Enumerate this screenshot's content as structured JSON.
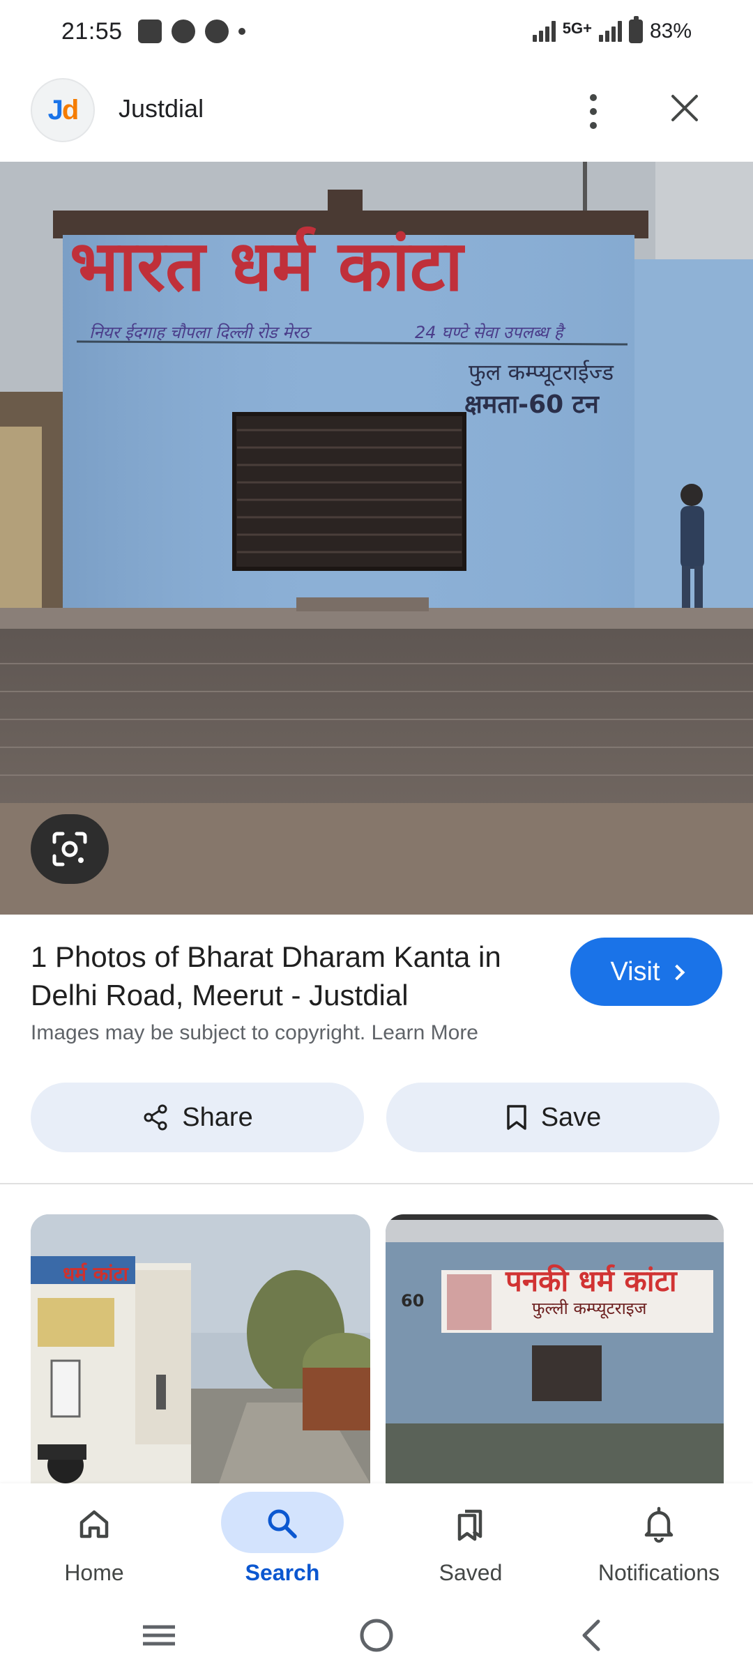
{
  "status_bar": {
    "time": "21:55",
    "network": "5G+",
    "battery": "83%",
    "icons": [
      "screen-cast-icon",
      "compass-icon",
      "facebook-icon",
      "notification-dot-icon",
      "signal-icon",
      "battery-icon"
    ]
  },
  "header": {
    "site_name": "Justdial",
    "logo_j": "J",
    "logo_d": "d",
    "more_icon": "more-vert-icon",
    "close_icon": "close-icon"
  },
  "main_image": {
    "sign_main": "भारत धर्म कांटा",
    "sign_sub_left": "नियर ईदगाह चौपला दिल्ली रोड मेरठ",
    "sign_sub_right": "24 घण्टे सेवा उपलब्ध है",
    "sign_side_1": "फुल कम्प्यूटराईज्ड",
    "sign_side_2": "क्षमता-60 टन",
    "lens_icon": "google-lens-icon"
  },
  "result": {
    "title": "1 Photos of Bharat Dharam Kanta in Delhi Road, Meerut - Justdial",
    "visit_label": "Visit",
    "copyright_text": "Images may be subject to copyright.",
    "learn_more": "Learn More",
    "share_label": "Share",
    "save_label": "Save"
  },
  "related": {
    "thumb1_sign": "धर्म कांटा",
    "thumb2_sign": "पनकी धर्म कांटा",
    "thumb2_sub": "फुल्ली कम्प्यूटराइज",
    "thumb2_num": "60"
  },
  "bottom_nav": {
    "items": [
      {
        "label": "Home",
        "icon": "home-icon",
        "active": false
      },
      {
        "label": "Search",
        "icon": "search-icon",
        "active": true
      },
      {
        "label": "Saved",
        "icon": "saved-icon",
        "active": false
      },
      {
        "label": "Notifications",
        "icon": "bell-icon",
        "active": false
      }
    ]
  },
  "colors": {
    "accent": "#1a73e8",
    "active_nav": "#0b57d0",
    "active_pill": "#d3e3fd",
    "chip_bg": "#e8eef8"
  }
}
